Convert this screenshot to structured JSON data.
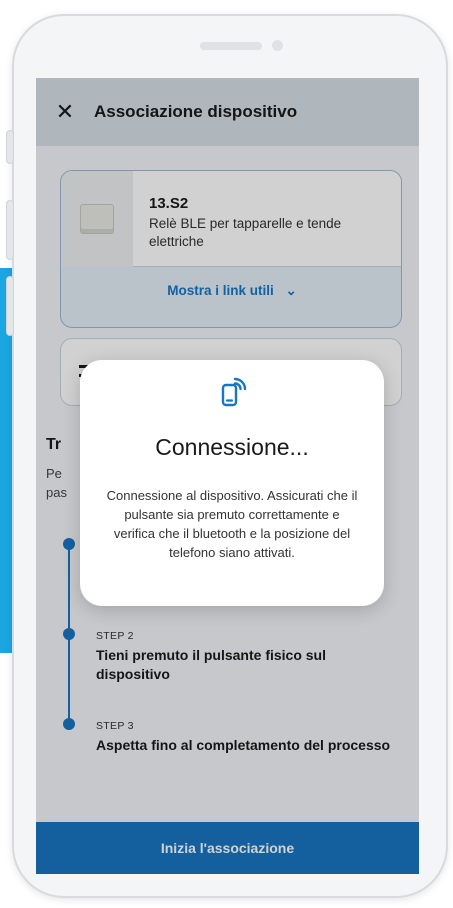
{
  "header": {
    "title": "Associazione dispositivo"
  },
  "product": {
    "name": "13.S2",
    "description": "Relè BLE per tapparelle e tende elettriche",
    "links_label": "Mostra i link utili"
  },
  "second_card": {
    "label": "T"
  },
  "instructions": {
    "title": "Tr",
    "description": "Pe\npas"
  },
  "steps": [
    {
      "label": "",
      "text": ""
    },
    {
      "label": "STEP 2",
      "text": "Tieni premuto il pulsante fisico sul dispositivo"
    },
    {
      "label": "STEP 3",
      "text": "Aspetta fino al completamento del processo"
    }
  ],
  "cta": {
    "label": "Inizia l'associazione"
  },
  "modal": {
    "title": "Connessione...",
    "message": "Connessione al dispositivo. Assicurati che il pulsante sia premuto correttamente e verifica che il bluetooth e la posizione del telefono siano attivati."
  },
  "colors": {
    "accent": "#1976c2",
    "appbar": "#d6dee6",
    "background_strip": "#1aa6e0"
  }
}
